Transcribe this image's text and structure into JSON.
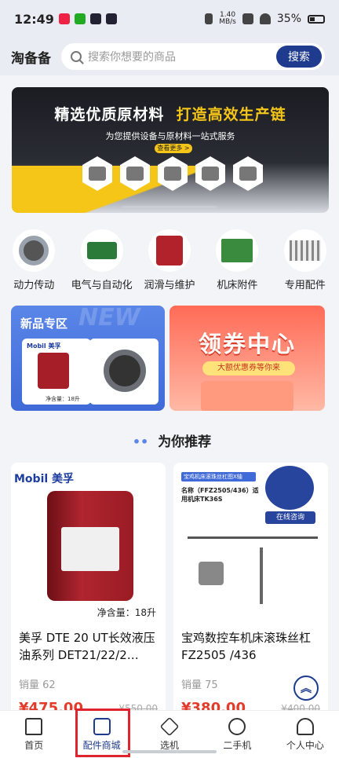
{
  "status_bar": {
    "time": "12:49",
    "net_speed_value": "1.40",
    "net_speed_unit": "MB/s",
    "battery_percent": "35%"
  },
  "header": {
    "app_title": "淘备备",
    "search_placeholder": "搜索你想要的商品",
    "search_button": "搜索"
  },
  "banner": {
    "title_part1": "精选优质原材料",
    "title_part2": "打造高效生产链",
    "subtitle": "为您提供设备与原材料一站式服务",
    "button": "查看更多 >"
  },
  "categories": [
    {
      "label": "动力传动",
      "icon": "bearing-icon"
    },
    {
      "label": "电气与自动化",
      "icon": "electric-module-icon"
    },
    {
      "label": "润滑与维护",
      "icon": "oil-bucket-icon"
    },
    {
      "label": "机床附件",
      "icon": "fixture-plate-icon"
    },
    {
      "label": "专用配件",
      "icon": "cutting-tools-icon"
    }
  ],
  "promos": {
    "new_title": "新品专区",
    "new_bg_text": "NEW",
    "new_card1_brand": "Mobil 美孚",
    "new_card1_net": "净含量：18升",
    "coupon_title": "领券中心",
    "coupon_sub": "大额优惠券等你来"
  },
  "recommend": {
    "title": "为你推荐"
  },
  "products": [
    {
      "brand": "Mobil 美孚",
      "net_weight": "净含量：18升",
      "name": "美孚 DTE 20 UT长效液压油系列 DET21/22/2…",
      "sales": "销量 62",
      "price": "¥475.00",
      "original_price": "¥550.00"
    },
    {
      "image_header": "宝鸡机床滚珠丝杠图X轴",
      "image_text": "名称（FFZ2505/436）适用机床TK36S",
      "online_tag": "在线咨询",
      "name": "宝鸡数控车机床滚珠丝杠FZ2505 /436",
      "sales": "销量 75",
      "price": "¥380.00",
      "original_price": "¥400.00"
    }
  ],
  "bottom_nav": [
    {
      "label": "首页",
      "icon": "home-icon",
      "active": false
    },
    {
      "label": "配件商城",
      "icon": "parts-mall-icon",
      "active": true
    },
    {
      "label": "选机",
      "icon": "layers-icon",
      "active": false
    },
    {
      "label": "二手机",
      "icon": "swap-icon",
      "active": false
    },
    {
      "label": "个人中心",
      "icon": "user-icon",
      "active": false
    }
  ],
  "colors": {
    "brand_blue": "#1f3b8e",
    "price_red": "#e23b2a",
    "highlight_red": "#e0232d"
  }
}
